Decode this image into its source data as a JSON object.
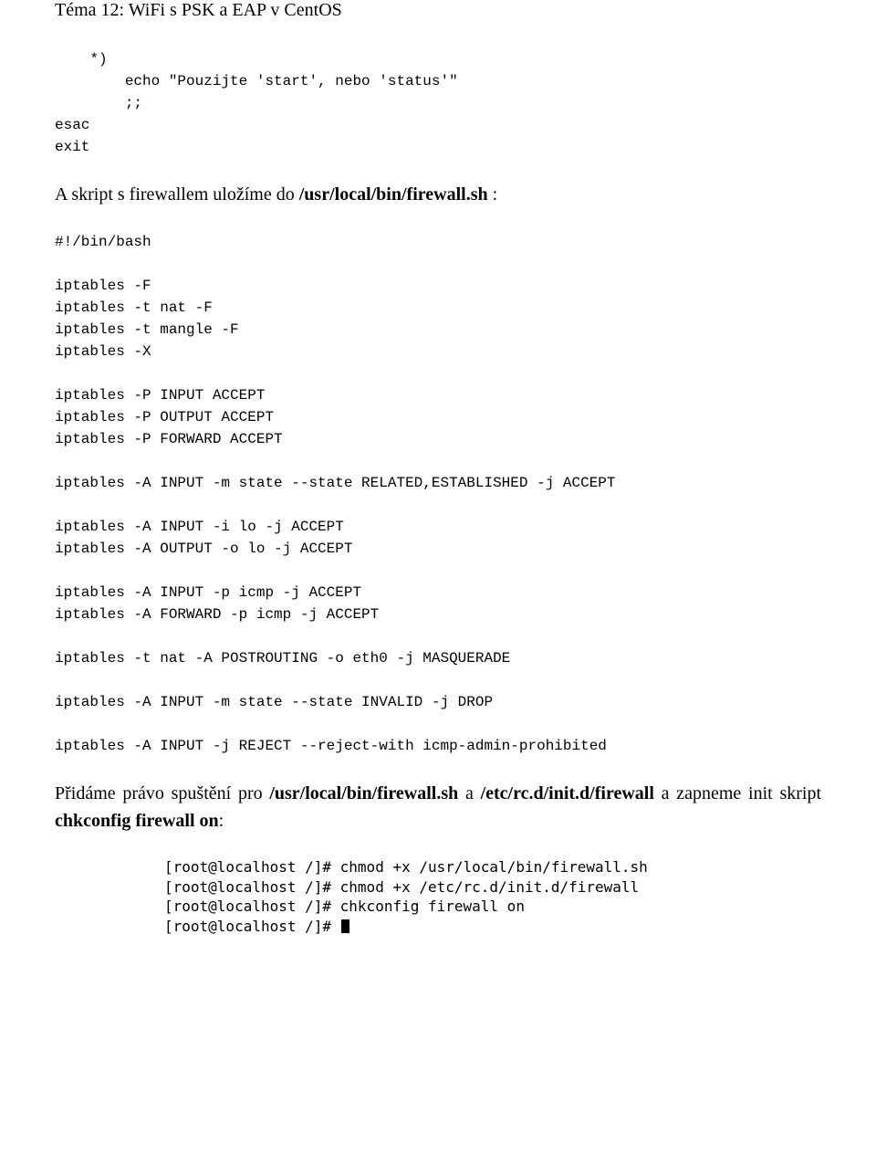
{
  "header": "Téma 12: WiFi s PSK a EAP v CentOS",
  "code1": "    *)\n        echo \"Pouzijte 'start', nebo 'status'\"\n        ;;\nesac\nexit",
  "para1_prefix": "A skript s firewallem uložíme do ",
  "para1_bold": "/usr/local/bin/firewall.sh",
  "para1_suffix": " :",
  "code2": "#!/bin/bash\n\niptables -F\niptables -t nat -F\niptables -t mangle -F\niptables -X\n\niptables -P INPUT ACCEPT\niptables -P OUTPUT ACCEPT\niptables -P FORWARD ACCEPT\n\niptables -A INPUT -m state --state RELATED,ESTABLISHED -j ACCEPT\n\niptables -A INPUT -i lo -j ACCEPT\niptables -A OUTPUT -o lo -j ACCEPT\n\niptables -A INPUT -p icmp -j ACCEPT\niptables -A FORWARD -p icmp -j ACCEPT\n\niptables -t nat -A POSTROUTING -o eth0 -j MASQUERADE\n\niptables -A INPUT -m state --state INVALID -j DROP\n\niptables -A INPUT -j REJECT --reject-with icmp-admin-prohibited",
  "para2_a": "Přidáme právo spuštění pro ",
  "para2_b": "/usr/local/bin/firewall.sh",
  "para2_c": " a ",
  "para2_d": "/etc/rc.d/init.d/firewall",
  "para2_e": " a zapneme init skript ",
  "para2_f": "chkconfig firewall on",
  "para2_g": ":",
  "term": {
    "l1": "[root@localhost /]# chmod +x /usr/local/bin/firewall.sh",
    "l2": "[root@localhost /]# chmod +x /etc/rc.d/init.d/firewall",
    "l3": "[root@localhost /]# chkconfig firewall on",
    "l4": "[root@localhost /]# "
  }
}
